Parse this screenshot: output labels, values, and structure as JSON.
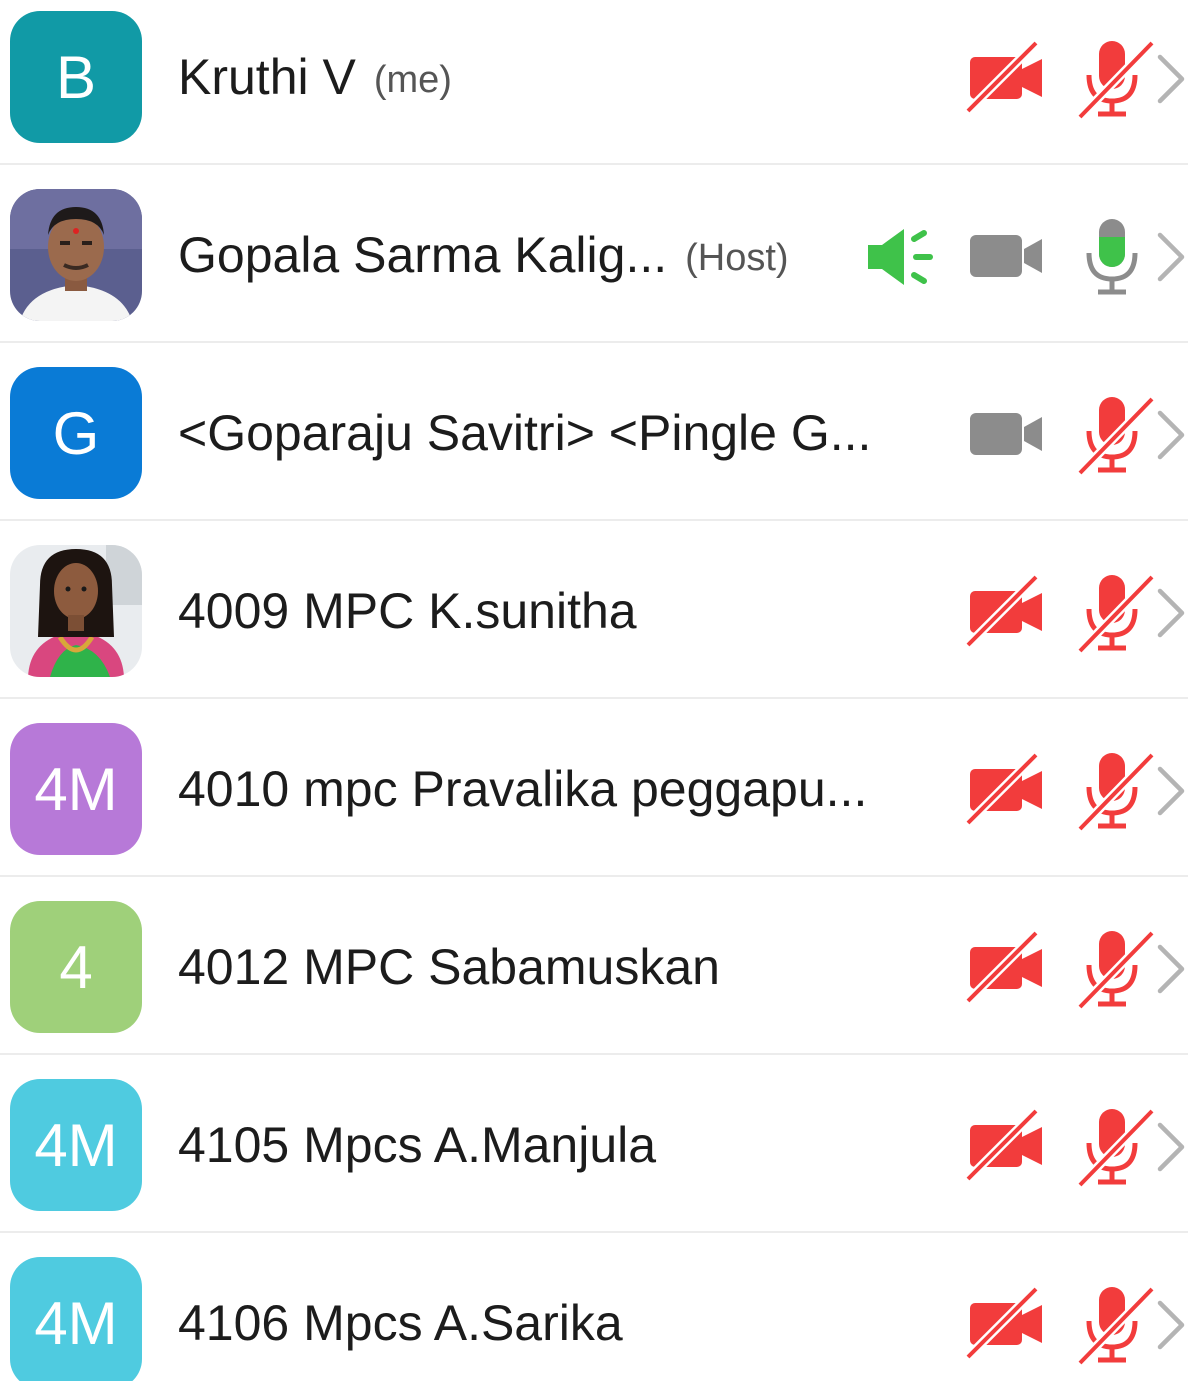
{
  "participants": [
    {
      "avatar_text": "B",
      "avatar_color": "#119aa6",
      "name": "Kruthi V",
      "tag": "(me)",
      "speaking": false,
      "video": "off",
      "audio": "muted"
    },
    {
      "avatar_text": "",
      "avatar_photo": "man-portrait",
      "name": "Gopala Sarma Kalig...",
      "tag": "(Host)",
      "speaking": true,
      "video": "on",
      "audio": "active"
    },
    {
      "avatar_text": "G",
      "avatar_color": "#0a7bd6",
      "name": "<Goparaju Savitri> <Pingle G...",
      "tag": "",
      "speaking": false,
      "video": "on",
      "audio": "muted"
    },
    {
      "avatar_text": "",
      "avatar_photo": "woman-portrait",
      "name": "4009 MPC K.sunitha",
      "tag": "",
      "speaking": false,
      "video": "off",
      "audio": "muted"
    },
    {
      "avatar_text": "4M",
      "avatar_color": "#b779d8",
      "name": "4010 mpc Pravalika peggapu...",
      "tag": "",
      "speaking": false,
      "video": "off",
      "audio": "muted"
    },
    {
      "avatar_text": "4",
      "avatar_color": "#9fd07a",
      "name": "4012  MPC Sabamuskan",
      "tag": "",
      "speaking": false,
      "video": "off",
      "audio": "muted"
    },
    {
      "avatar_text": "4M",
      "avatar_color": "#4fcbe0",
      "name": "4105 Mpcs A.Manjula",
      "tag": "",
      "speaking": false,
      "video": "off",
      "audio": "muted"
    },
    {
      "avatar_text": "4M",
      "avatar_color": "#4fcbe0",
      "name": "4106 Mpcs A.Sarika",
      "tag": "",
      "speaking": false,
      "video": "off",
      "audio": "muted"
    }
  ],
  "colors": {
    "muted_red": "#f23c3c",
    "active_green": "#3fc24a",
    "icon_gray": "#8c8c8c",
    "chevron_gray": "#b4b4b4"
  },
  "icons": {
    "video_off": "video-off-icon",
    "video_on": "video-icon",
    "mic_muted": "mic-muted-icon",
    "mic_active": "mic-active-icon",
    "speaking": "speaker-icon",
    "row_action": "chevron-right-icon"
  }
}
